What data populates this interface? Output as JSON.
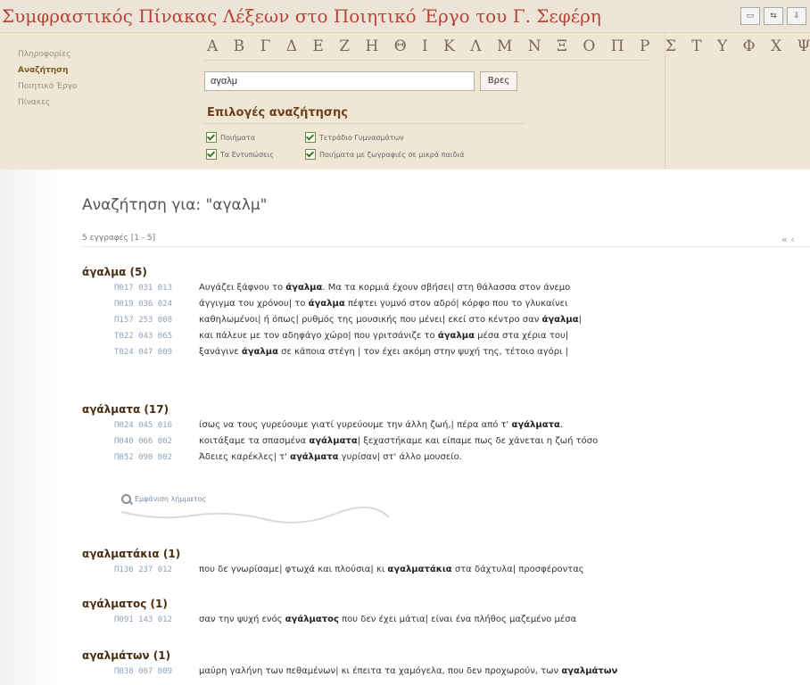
{
  "app": {
    "title": "Συμφραστικός Πίνακας Λέξεων στο Ποιητικό Έργο του Γ. Σεφέρη"
  },
  "window_buttons": [
    "▭",
    "⇆",
    "⇩"
  ],
  "sidebar": {
    "items": [
      {
        "label": "Πληροφορίες"
      },
      {
        "label": "Αναζήτηση"
      },
      {
        "label": "Ποιητικό Έργο"
      },
      {
        "label": "Πίνακες"
      }
    ]
  },
  "alphabet": "Α Β Γ Δ Ε Ζ Η Θ Ι Κ Λ Μ Ν Ξ Ο Π Ρ Σ Τ Υ Φ Χ Ψ Ω",
  "search": {
    "value": "αγαλμ",
    "button_label": "Βρες"
  },
  "options": {
    "title": "Επιλογές αναζήτησης",
    "items": [
      {
        "label": "Ποιήματα",
        "checked": true
      },
      {
        "label": "Τετράδιο Γυμνασμάτων",
        "checked": true
      },
      {
        "label": "Τα Εντυπώσεις",
        "checked": true
      },
      {
        "label": "Ποιήματα με ζωγραφιές σε μικρά παιδιά",
        "checked": true
      }
    ]
  },
  "results": {
    "heading": "Αναζήτηση για: \"αγαλμ\"",
    "count": "5 εγγραφές [1 - 5]",
    "pager": "« ‹",
    "similar_link": "Εμφάνιση λήμματος",
    "groups": [
      {
        "word": "άγαλμα (5)",
        "rows": [
          {
            "ref": "Π017 031 013",
            "before": "Αυγάζει ξάφνου το ",
            "match": "άγαλμα",
            "after": ". Μα τα κορμιά έχουν σβήσει| στη θάλασσα στον άνεμο"
          },
          {
            "ref": "Π019 036 024",
            "before": "άγγιγμα του χρόνου| το ",
            "match": "άγαλμα",
            "after": " πέφτει γυμνό στον αδρό| κόρφο που το γλυκαίνει"
          },
          {
            "ref": "Π157 253 008",
            "before": "καθηλωμένοι| ή όπως| ρυθμός της μουσικής που μένει| εκεί στο κέντρο σαν ",
            "match": "άγαλμα",
            "after": "|"
          },
          {
            "ref": "Τ022 043 065",
            "before": "και πάλευε με τον αδηφάγο χώρο| που γριτσάνιζε το ",
            "match": "άγαλμα",
            "after": " μέσα στα χέρια του|"
          },
          {
            "ref": "Τ024 047 009",
            "before": "ξανάγινε ",
            "match": "άγαλμα",
            "after": " σε κάποια στέγη | τον έχει ακόμη στην ψυχή της, τέτοιο αγόρι |"
          }
        ]
      },
      {
        "word": "αγάλματα (17)",
        "rows": [
          {
            "ref": "Π024 045 016",
            "before": "ίσως να τους γυρεύουμε γιατί γυρεύουμε την άλλη ζωή,| πέρα από τ' ",
            "match": "αγάλματα",
            "after": "."
          },
          {
            "ref": "Π040 066 002",
            "before": "κοιτάξαμε τα σπασμένα ",
            "match": "αγάλματα",
            "after": "| ξεχαστήκαμε και είπαμε πως δε χάνεται η ζωή τόσο"
          },
          {
            "ref": "Π052 090 002",
            "before": "Άδειες καρέκλες| τ' ",
            "match": "αγάλματα",
            "after": " γυρίσαν| στ' άλλο μουσείο."
          }
        ]
      },
      {
        "word": "αγαλματάκια (1)",
        "rows": [
          {
            "ref": "Π136 237 012",
            "before": "που δε γνωρίσαμε| φτωχά και πλούσια| κι ",
            "match": "αγαλματάκια",
            "after": " στα δάχτυλα| προσφέροντας"
          }
        ]
      },
      {
        "word": "αγάλματος (1)",
        "rows": [
          {
            "ref": "Π091 143 012",
            "before": "σαν την ψυχή ενός ",
            "match": "αγάλματος",
            "after": " που δεν έχει μάτια| είναι ένα πλήθος μαζεμένο μέσα"
          }
        ]
      },
      {
        "word": "αγαλμάτων (1)",
        "rows": [
          {
            "ref": "Π038 067 009",
            "before": "μαύρη γαλήνη των πεθαμένων| κι έπειτα τα χαμόγελα, που δεν προχωρούν, των ",
            "match": "αγαλμάτων",
            "after": ""
          }
        ]
      }
    ]
  }
}
